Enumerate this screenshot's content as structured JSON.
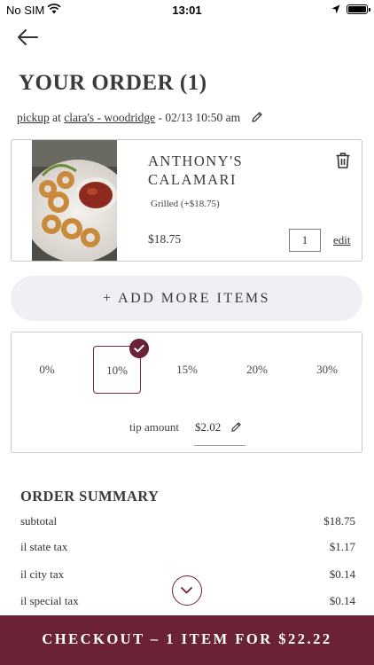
{
  "status_bar": {
    "carrier": "No SIM",
    "time": "13:01"
  },
  "header": {
    "title": "YOUR ORDER (1)"
  },
  "pickup": {
    "method": "pickup",
    "at": "at",
    "location": "clara's - woodridge",
    "datetime": "- 02/13 10:50 am"
  },
  "cart": {
    "items": [
      {
        "name": "ANTHONY'S CALAMARI",
        "modifier": "Grilled (+$18.75)",
        "price": "$18.75",
        "quantity": "1",
        "edit_label": "edit"
      }
    ]
  },
  "add_more_label": "+ ADD MORE ITEMS",
  "tip": {
    "options": [
      "0%",
      "10%",
      "15%",
      "20%",
      "30%"
    ],
    "selected": "10%",
    "amount_label": "tip amount",
    "amount_value": "$2.02"
  },
  "summary": {
    "title": "ORDER SUMMARY",
    "rows": [
      {
        "label": "subtotal",
        "value": "$18.75"
      },
      {
        "label": "il state tax",
        "value": "$1.17"
      },
      {
        "label": "il city tax",
        "value": "$0.14"
      },
      {
        "label": "il special tax",
        "value": "$0.14"
      }
    ]
  },
  "checkout_label": "CHECKOUT – 1 ITEM FOR $22.22",
  "colors": {
    "brand": "#6b2236",
    "add_more_bg": "#f1eff4",
    "border": "#c9c9c9"
  },
  "icons": {
    "back": "arrow-left-icon",
    "edit": "pencil-icon",
    "delete": "trash-icon",
    "selected": "check-circle-icon",
    "scroll": "chevron-down-icon"
  }
}
